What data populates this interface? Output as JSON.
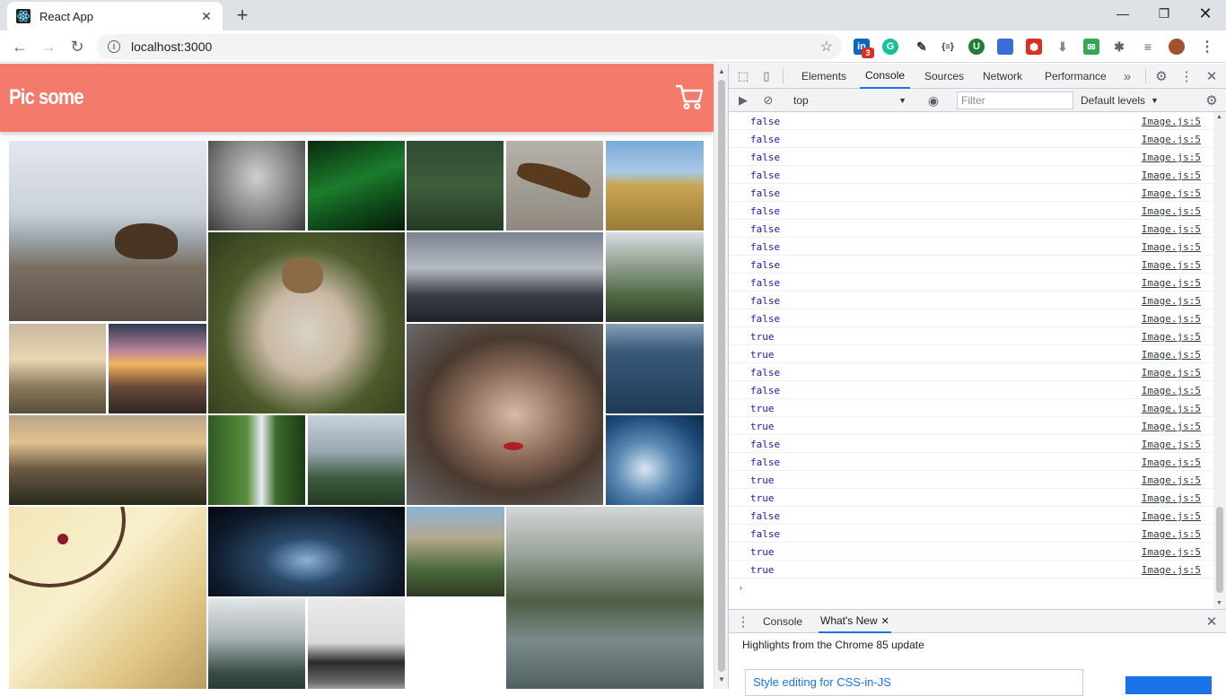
{
  "browser": {
    "tab_title": "React App",
    "url": "localhost:3000",
    "notif_count": "3"
  },
  "app": {
    "title": "Pic some",
    "header_color": "#f47b6c"
  },
  "gallery": {
    "images": [
      {
        "name": "bear-on-rocks"
      },
      {
        "name": "misty-forest"
      },
      {
        "name": "aurora-green"
      },
      {
        "name": "forest-canopy"
      },
      {
        "name": "eagle-flying"
      },
      {
        "name": "feet-in-field"
      },
      {
        "name": "pug-in-blanket"
      },
      {
        "name": "skyscraper-from-below"
      },
      {
        "name": "city-park-aerial"
      },
      {
        "name": "misty-sunrise-trees"
      },
      {
        "name": "sunset-rail"
      },
      {
        "name": "woman-portrait"
      },
      {
        "name": "ocean-boat"
      },
      {
        "name": "mountain-sunset-trees"
      },
      {
        "name": "waterfall"
      },
      {
        "name": "castle"
      },
      {
        "name": "ocean-wave"
      },
      {
        "name": "dreamcatcher"
      },
      {
        "name": "star-trails"
      },
      {
        "name": "yosemite-valley"
      },
      {
        "name": "misty-river-valley"
      },
      {
        "name": "foggy-mountains"
      },
      {
        "name": "sea-stacks"
      }
    ]
  },
  "devtools": {
    "tabs": [
      "Elements",
      "Console",
      "Sources",
      "Network",
      "Performance"
    ],
    "active_tab": "Console",
    "context": "top",
    "filter_placeholder": "Filter",
    "levels": "Default levels",
    "logs": [
      {
        "value": "false",
        "source": "Image.js:5"
      },
      {
        "value": "false",
        "source": "Image.js:5"
      },
      {
        "value": "false",
        "source": "Image.js:5"
      },
      {
        "value": "false",
        "source": "Image.js:5"
      },
      {
        "value": "false",
        "source": "Image.js:5"
      },
      {
        "value": "false",
        "source": "Image.js:5"
      },
      {
        "value": "false",
        "source": "Image.js:5"
      },
      {
        "value": "false",
        "source": "Image.js:5"
      },
      {
        "value": "false",
        "source": "Image.js:5"
      },
      {
        "value": "false",
        "source": "Image.js:5"
      },
      {
        "value": "false",
        "source": "Image.js:5"
      },
      {
        "value": "false",
        "source": "Image.js:5"
      },
      {
        "value": "true",
        "source": "Image.js:5"
      },
      {
        "value": "true",
        "source": "Image.js:5"
      },
      {
        "value": "false",
        "source": "Image.js:5"
      },
      {
        "value": "false",
        "source": "Image.js:5"
      },
      {
        "value": "true",
        "source": "Image.js:5"
      },
      {
        "value": "true",
        "source": "Image.js:5"
      },
      {
        "value": "false",
        "source": "Image.js:5"
      },
      {
        "value": "false",
        "source": "Image.js:5"
      },
      {
        "value": "true",
        "source": "Image.js:5"
      },
      {
        "value": "true",
        "source": "Image.js:5"
      },
      {
        "value": "false",
        "source": "Image.js:5"
      },
      {
        "value": "false",
        "source": "Image.js:5"
      },
      {
        "value": "true",
        "source": "Image.js:5"
      },
      {
        "value": "true",
        "source": "Image.js:5"
      }
    ],
    "drawer": {
      "tabs": [
        "Console",
        "What's New"
      ],
      "active": "What's New",
      "heading": "Highlights from the Chrome 85 update",
      "card": "Style editing for CSS-in-JS"
    }
  }
}
